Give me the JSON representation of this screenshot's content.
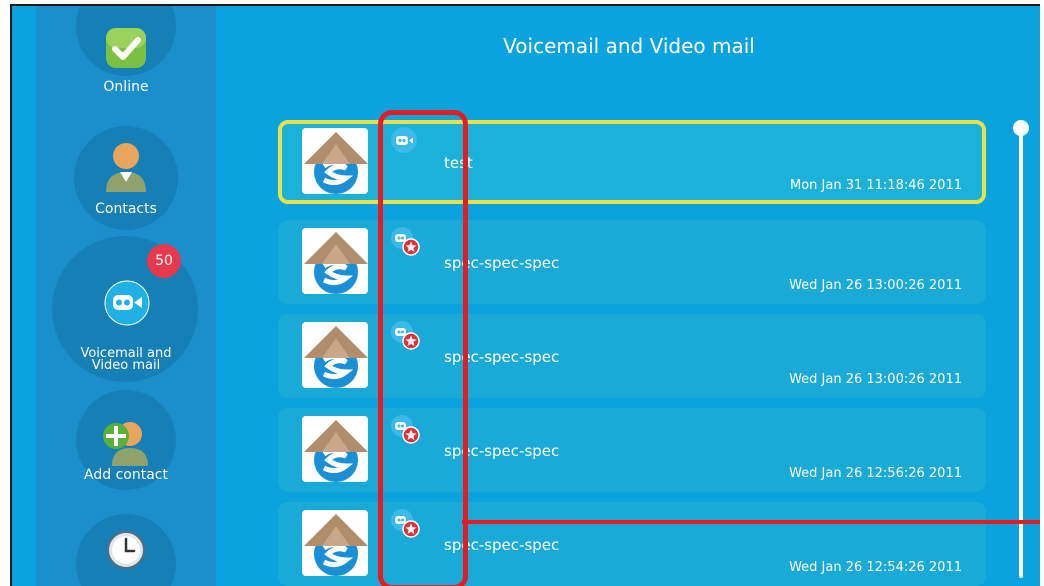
{
  "header": {
    "title": "Voicemail and Video mail"
  },
  "sidebar": {
    "items": [
      {
        "label": "Online",
        "icon": "check-status-icon"
      },
      {
        "label": "Contacts",
        "icon": "contact-person-icon"
      },
      {
        "label": "Voicemail and\nVideo mail",
        "icon": "videomail-icon",
        "badge": "50"
      },
      {
        "label": "Add contact",
        "icon": "add-contact-icon"
      },
      {
        "label": "",
        "icon": "clock-icon"
      }
    ]
  },
  "messages": [
    {
      "name": "test",
      "date": "Mon Jan 31 11:18:46 2011",
      "icon": "videomail-read-icon",
      "selected": true
    },
    {
      "name": "spec-spec-spec",
      "date": "Wed Jan 26 13:00:26 2011",
      "icon": "videomail-new-icon"
    },
    {
      "name": "spec-spec-spec",
      "date": "Wed Jan 26 13:00:26 2011",
      "icon": "videomail-new-icon"
    },
    {
      "name": "spec-spec-spec",
      "date": "Wed Jan 26 12:56:26 2011",
      "icon": "videomail-new-icon"
    },
    {
      "name": "spec-spec-spec",
      "date": "Wed Jan 26 12:54:26 2011",
      "icon": "videomail-new-icon"
    }
  ],
  "colors": {
    "background": "#0ba3dd",
    "sidebar": "#1a8fcb",
    "row": "#1aaad8",
    "selected_border": "#e6e24a",
    "badge": "#e8384c",
    "annotation": "#e21d24"
  }
}
